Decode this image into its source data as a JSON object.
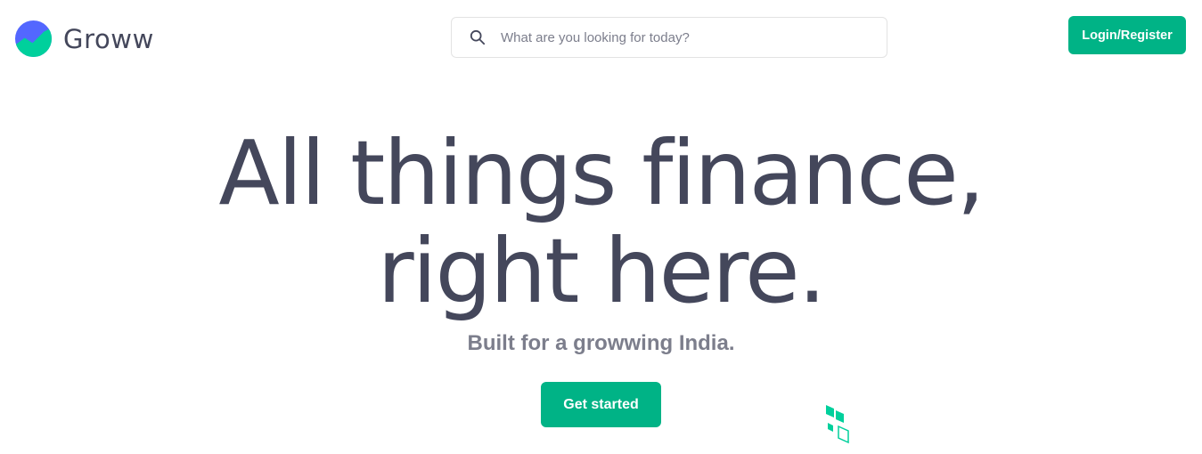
{
  "header": {
    "logo_text": "Groww",
    "logo_icon": "groww-logo-icon",
    "search": {
      "icon": "search-icon",
      "placeholder": "What are you looking for today?"
    },
    "login_label": "Login/Register"
  },
  "hero": {
    "title_line1": "All things finance,",
    "title_line2": "right here.",
    "subtitle": "Built for a growwing India.",
    "cta_label": "Get started"
  },
  "colors": {
    "brand_green": "#00b386",
    "text_dark": "#44475b",
    "text_muted": "#7c7e8c",
    "logo_blue": "#5367ff"
  }
}
